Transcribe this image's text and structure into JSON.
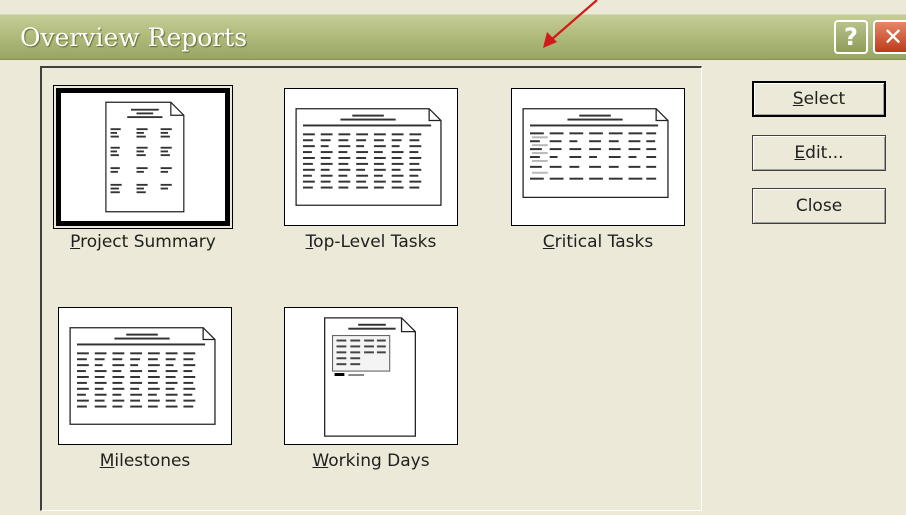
{
  "window": {
    "title": "Overview Reports",
    "help_glyph": "?",
    "close_glyph": "✕",
    "title_bar_color": "#b1bc7d",
    "face_color": "#ece9d8",
    "annotation_arrow_color": "#d21a1a"
  },
  "reports": [
    {
      "label_mnemonic": "P",
      "label_rest": "roject Summary",
      "icon": "project-summary-report-icon",
      "selected": true
    },
    {
      "label_mnemonic": "T",
      "label_rest": "op-Level Tasks",
      "icon": "top-level-tasks-report-icon",
      "selected": false
    },
    {
      "label_mnemonic": "C",
      "label_rest": "ritical Tasks",
      "icon": "critical-tasks-report-icon",
      "selected": false
    },
    {
      "label_mnemonic": "M",
      "label_rest": "ilestones",
      "icon": "milestones-report-icon",
      "selected": false
    },
    {
      "label_mnemonic": "W",
      "label_rest": "orking Days",
      "icon": "working-days-report-icon",
      "selected": false
    }
  ],
  "buttons": {
    "select": {
      "mnemonic": "S",
      "rest": "elect"
    },
    "edit": {
      "mnemonic": "E",
      "rest": "dit..."
    },
    "close": {
      "label": "Close"
    }
  }
}
